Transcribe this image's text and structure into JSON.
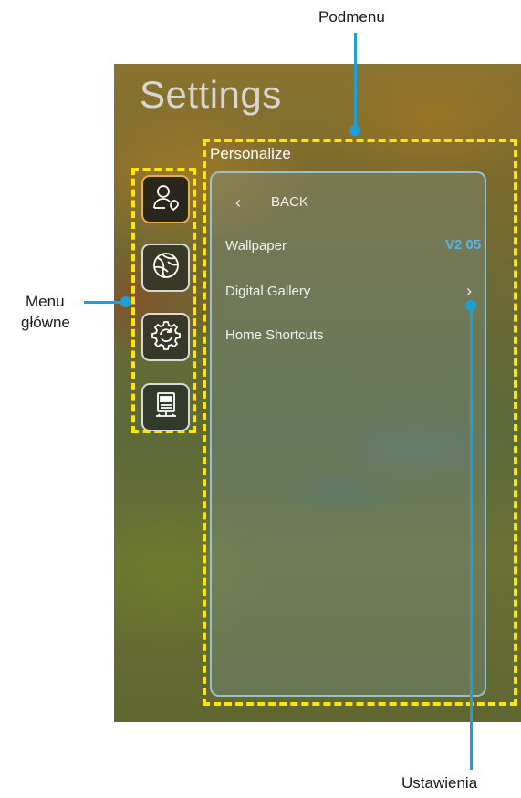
{
  "annotations": {
    "submenu": "Podmenu",
    "main_menu_line1": "Menu",
    "main_menu_line2": "główne",
    "settings": "Ustawienia"
  },
  "screen": {
    "title": "Settings",
    "submenu_title": "Personalize",
    "back_label": "BACK",
    "items": [
      {
        "label": "Wallpaper",
        "value": "V2 05"
      },
      {
        "label": "Digital Gallery",
        "value": ""
      },
      {
        "label": "Home Shortcuts",
        "value": ""
      }
    ]
  },
  "menu_icons": [
    "personalize-icon",
    "network-icon",
    "system-icon",
    "info-icon"
  ],
  "colors": {
    "annotation_line": "#1e9fd8",
    "highlight_dash": "#ffe600",
    "value_text": "#57b6e8",
    "active_border": "#e0b14a"
  }
}
